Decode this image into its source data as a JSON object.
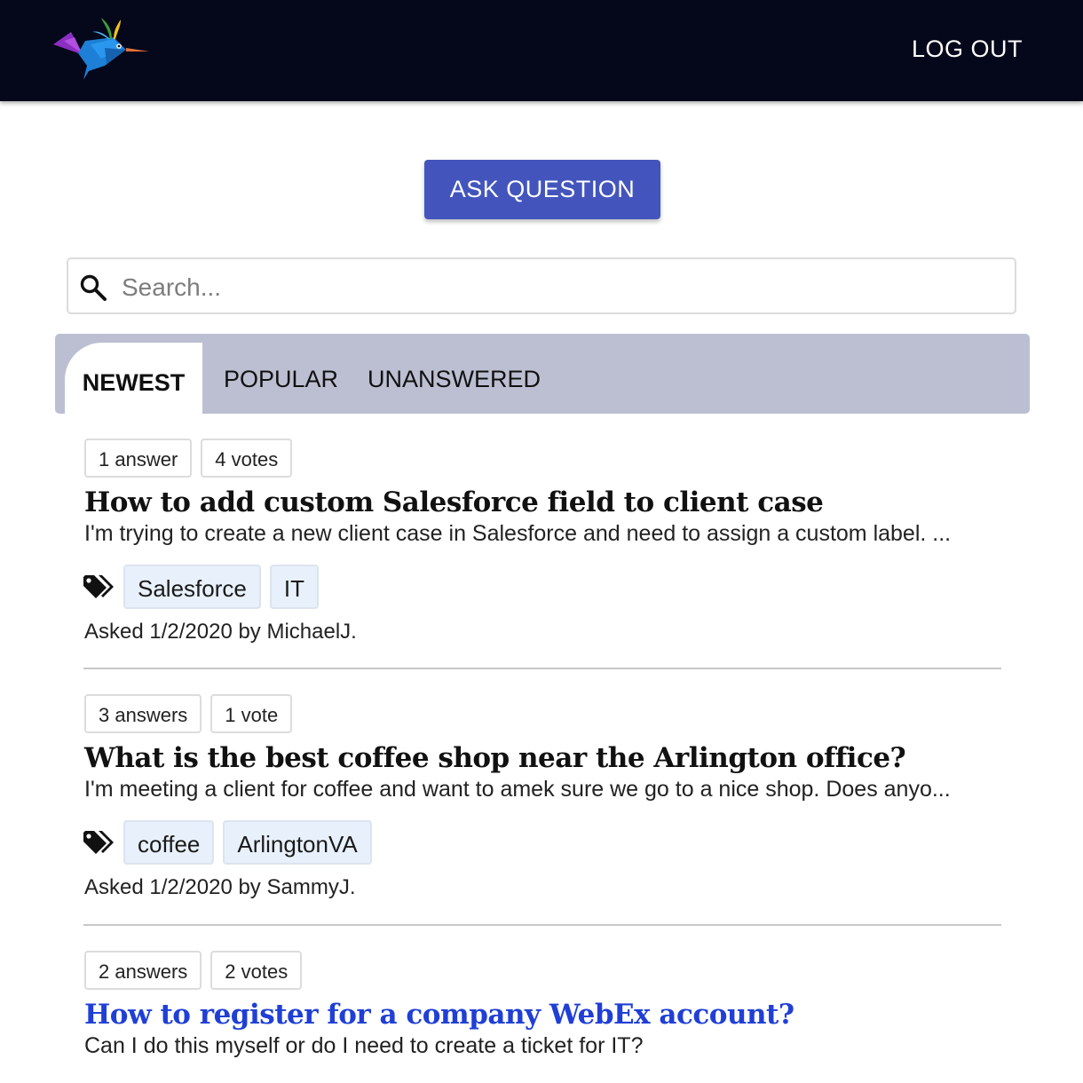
{
  "header": {
    "logo_name": "bird-logo",
    "logout_label": "LOG OUT"
  },
  "ask_button_label": "ASK QUESTION",
  "search": {
    "placeholder": "Search...",
    "value": ""
  },
  "tabs": [
    {
      "label": "NEWEST",
      "active": true
    },
    {
      "label": "POPULAR",
      "active": false
    },
    {
      "label": "UNANSWERED",
      "active": false
    }
  ],
  "questions": [
    {
      "answers": "1 answer",
      "votes": "4 votes",
      "title": "How to add custom Salesforce field to client case",
      "excerpt": "I'm trying to create a new client case in Salesforce and need to assign a custom label. ...",
      "tags": [
        "Salesforce",
        "IT"
      ],
      "asked": "Asked 1/2/2020 by MichaelJ."
    },
    {
      "answers": "3 answers",
      "votes": "1 vote",
      "title": "What is the best coffee shop near the Arlington office?",
      "excerpt": "I'm meeting a client for coffee and want to amek sure we go to a nice shop. Does anyo...",
      "tags": [
        "coffee",
        "ArlingtonVA"
      ],
      "asked": "Asked 1/2/2020 by SammyJ."
    },
    {
      "answers": "2 answers",
      "votes": "2 votes",
      "title": "How to register for a company WebEx account?",
      "excerpt": "Can I do this myself or do I need to create a ticket for IT?",
      "tags": [],
      "asked": ""
    }
  ],
  "colors": {
    "header_bg": "#05071a",
    "primary": "#4355bd",
    "tabs_bg": "#bbbfd1",
    "link": "#1f3fd6",
    "tag_bg": "#e8f1fb"
  }
}
